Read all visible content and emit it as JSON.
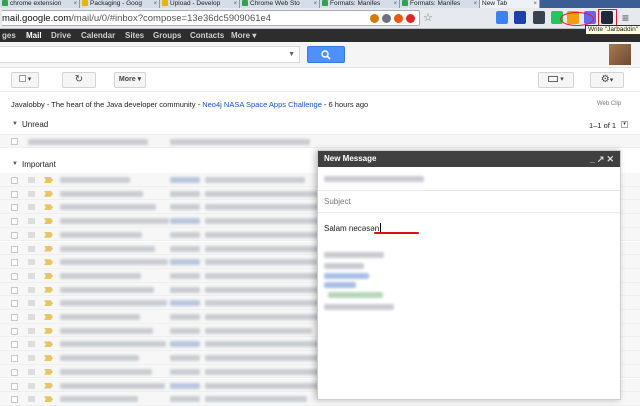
{
  "browser": {
    "tabs": [
      {
        "label": "chrome extension",
        "color": "#2ea44f"
      },
      {
        "label": "Packaging - Goog",
        "color": "#eab308"
      },
      {
        "label": "Upload - Develop",
        "color": "#eab308"
      },
      {
        "label": "Chrome Web Sto",
        "color": "#2ea44f"
      },
      {
        "label": "Formats: Manifes",
        "color": "#2ea44f"
      },
      {
        "label": "Formats: Manifes",
        "color": "#2ea44f"
      },
      {
        "label": "New Tab",
        "color": "#cccccc"
      }
    ],
    "address": {
      "domain": "mail.google.com",
      "path": "/mail/u/0/#inbox?compose=13e36dc5909061e4"
    },
    "extension_tooltip": "Write \"Jarbaddin\""
  },
  "gbar": {
    "items": [
      {
        "label": "ges"
      },
      {
        "label": "Mail"
      },
      {
        "label": "Drive"
      },
      {
        "label": "Calendar"
      },
      {
        "label": "Sites"
      },
      {
        "label": "Groups"
      },
      {
        "label": "Contacts"
      },
      {
        "label": "More ▾"
      }
    ]
  },
  "toolbar": {
    "more_label": "More ▾"
  },
  "webclip": {
    "source": "Javalobby - The heart of the Java developer community - ",
    "link": "Neo4j NASA Space Apps Challenge",
    "time": " - 6 hours ago",
    "right_label": "Web Clip"
  },
  "sections": {
    "unread": "Unread",
    "unread_count": "1–1 of 1",
    "important": "Important"
  },
  "compose": {
    "title": "New Message",
    "subject_placeholder": "Subject",
    "body_text": "Salam necəsən"
  },
  "colors": {
    "gbar_bg": "#2d2d2d",
    "search_blue": "#4d90fe",
    "compose_header": "#404040"
  }
}
